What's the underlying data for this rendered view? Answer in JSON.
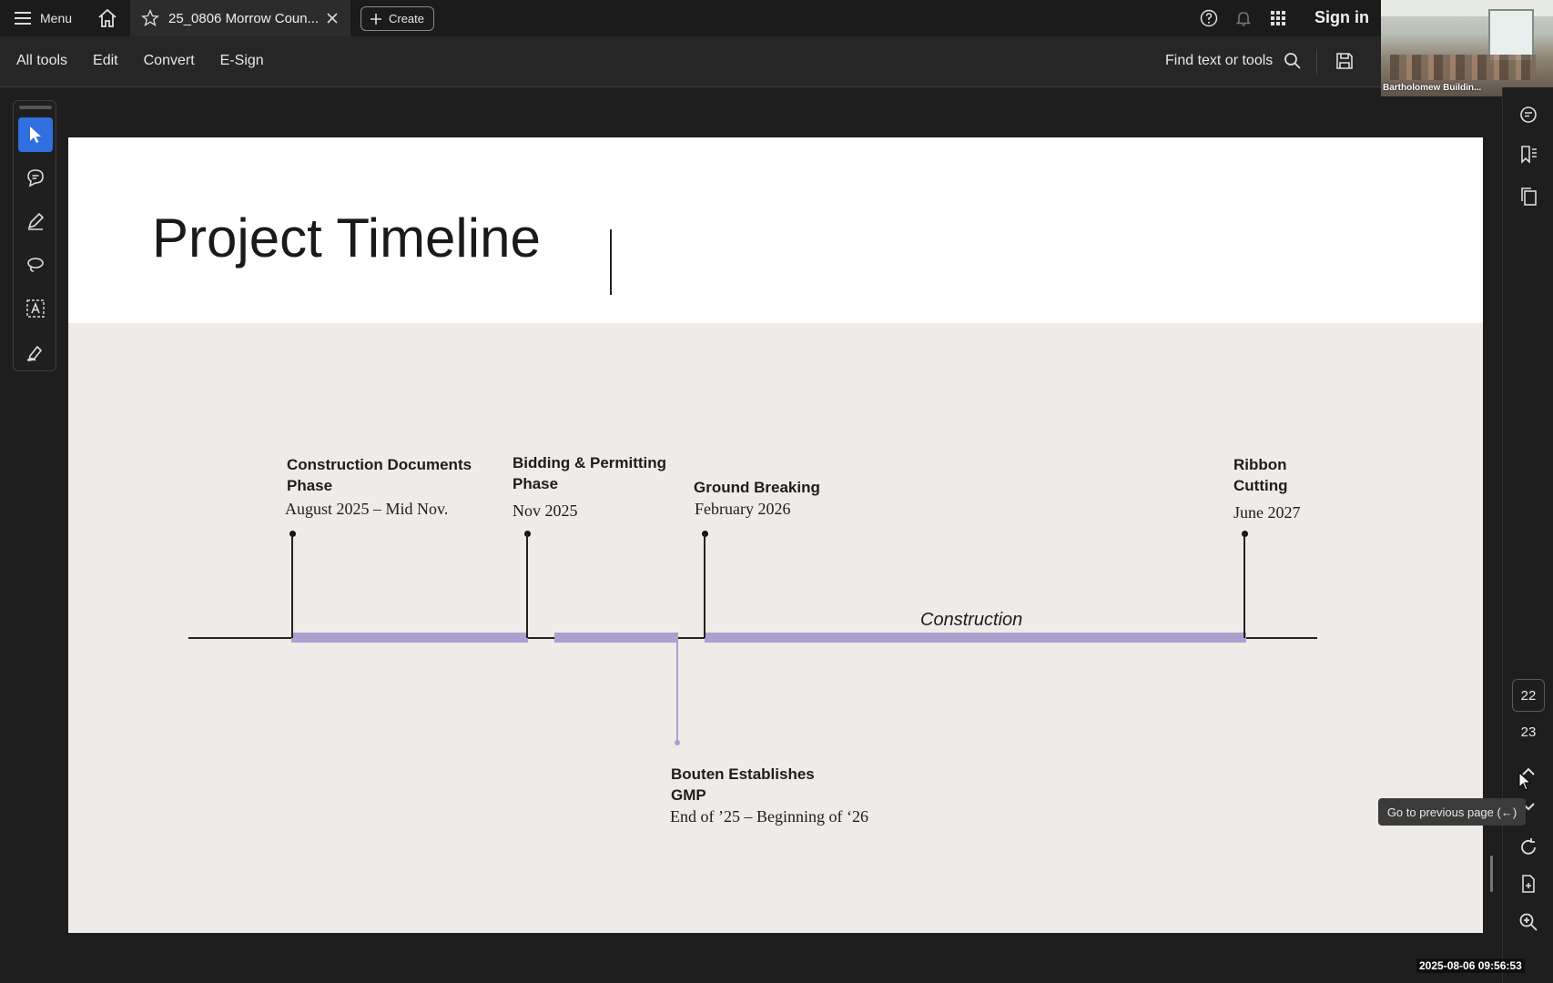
{
  "topbar": {
    "menu_label": "Menu",
    "tab_title": "25_0806 Morrow Coun...",
    "create_label": "Create",
    "signin_label": "Sign in"
  },
  "toolbar": {
    "items": [
      "All tools",
      "Edit",
      "Convert",
      "E-Sign"
    ],
    "find_label": "Find text or tools"
  },
  "video": {
    "caption": "Bartholomew Buildin..."
  },
  "slide": {
    "title": "Project Timeline",
    "milestones": [
      {
        "title_line1": "Construction Documents",
        "title_line2": "Phase",
        "date": "August 2025 – Mid Nov."
      },
      {
        "title_line1": "Bidding & Permitting",
        "title_line2": "Phase",
        "date": "Nov 2025"
      },
      {
        "title_line1": "Ground Breaking",
        "title_line2": "",
        "date": "February 2026"
      },
      {
        "title_line1": "Ribbon",
        "title_line2": "Cutting",
        "date": "June 2027"
      },
      {
        "title_line1": "Bouten Establishes",
        "title_line2": "GMP",
        "date": "End of ’25 – Beginning of ‘26"
      }
    ],
    "bar_label": "Construction"
  },
  "pages": {
    "current": "22",
    "next": "23"
  },
  "tooltip": "Go to previous page (←)",
  "timestamp": "2025-08-06 09:56:53",
  "colors": {
    "accent": "#2f6fe0",
    "timeline_bar": "#a9a2cf"
  }
}
